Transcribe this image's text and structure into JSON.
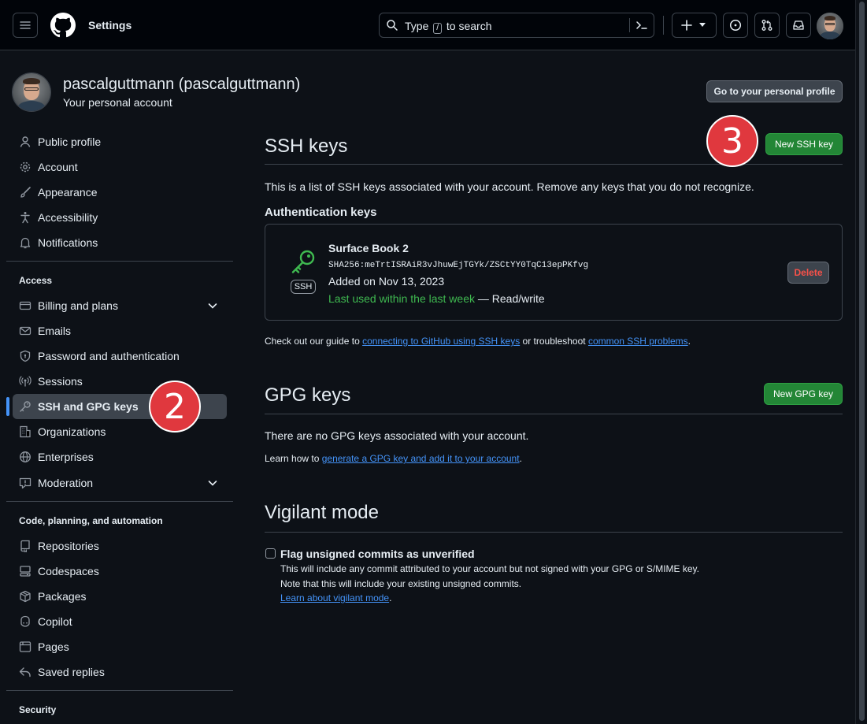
{
  "header": {
    "title": "Settings",
    "search_prefix": "Type",
    "search_slash": "/",
    "search_suffix": "to search"
  },
  "profile": {
    "name": "pascalguttmann (pascalguttmann)",
    "subtitle": "Your personal account",
    "go_profile_button": "Go to your personal profile"
  },
  "sidebar": {
    "group1": [
      {
        "label": "Public profile",
        "icon": "person-icon"
      },
      {
        "label": "Account",
        "icon": "gear-icon"
      },
      {
        "label": "Appearance",
        "icon": "paintbrush-icon"
      },
      {
        "label": "Accessibility",
        "icon": "accessibility-icon"
      },
      {
        "label": "Notifications",
        "icon": "bell-icon"
      }
    ],
    "access_heading": "Access",
    "access": [
      {
        "label": "Billing and plans",
        "icon": "credit-card-icon"
      },
      {
        "label": "Emails",
        "icon": "mail-icon"
      },
      {
        "label": "Password and authentication",
        "icon": "shield-lock-icon"
      },
      {
        "label": "Sessions",
        "icon": "broadcast-icon"
      },
      {
        "label": "SSH and GPG keys",
        "icon": "key-icon"
      },
      {
        "label": "Organizations",
        "icon": "organization-icon"
      },
      {
        "label": "Enterprises",
        "icon": "globe-icon"
      },
      {
        "label": "Moderation",
        "icon": "report-icon"
      }
    ],
    "code_heading": "Code, planning, and automation",
    "code": [
      {
        "label": "Repositories",
        "icon": "repo-icon"
      },
      {
        "label": "Codespaces",
        "icon": "codespaces-icon"
      },
      {
        "label": "Packages",
        "icon": "package-icon"
      },
      {
        "label": "Copilot",
        "icon": "copilot-icon"
      },
      {
        "label": "Pages",
        "icon": "browser-icon"
      },
      {
        "label": "Saved replies",
        "icon": "reply-icon"
      }
    ],
    "security_heading": "Security"
  },
  "ssh": {
    "title": "SSH keys",
    "new_button": "New SSH key",
    "description": "This is a list of SSH keys associated with your account. Remove any keys that you do not recognize.",
    "auth_heading": "Authentication keys",
    "key": {
      "name": "Surface Book 2",
      "fingerprint": "SHA256:meTrtISRAiR3vJhuwEjTGYk/ZSCtYY0TqC13epPKfvg",
      "added": "Added on Nov 13, 2023",
      "last_used": "Last used within the last week",
      "access": "— Read/write",
      "badge": "SSH",
      "delete_button": "Delete"
    },
    "guide_prefix": "Check out our guide to",
    "guide_link": "connecting to GitHub using SSH keys",
    "guide_middle": "or troubleshoot",
    "guide_link2": "common SSH problems",
    "guide_end": "."
  },
  "gpg": {
    "title": "GPG keys",
    "new_button": "New GPG key",
    "empty": "There are no GPG keys associated with your account.",
    "learn_prefix": "Learn how to",
    "learn_link": "generate a GPG key and add it to your account",
    "learn_end": "."
  },
  "vigilant": {
    "title": "Vigilant mode",
    "checkbox_label": "Flag unsigned commits as unverified",
    "checked": false,
    "line1": "This will include any commit attributed to your account but not signed with your GPG or S/MIME key.",
    "line2": "Note that this will include your existing unsigned commits.",
    "link": "Learn about vigilant mode",
    "link_end": "."
  },
  "markers": {
    "step2": "2",
    "step3": "3"
  },
  "colors": {
    "accent": "#4493f8",
    "green_button": "#238636",
    "danger": "#f85149",
    "marker": "#e0383e"
  }
}
